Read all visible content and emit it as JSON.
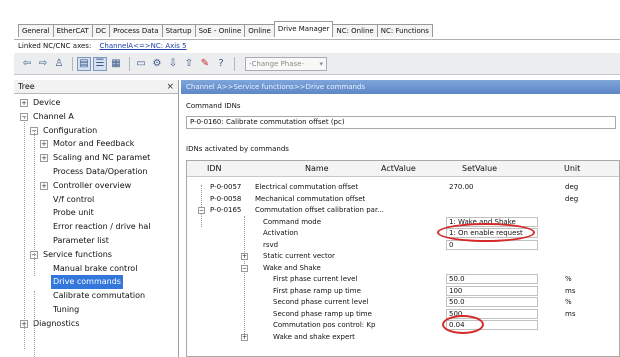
{
  "tabs": [
    "General",
    "EtherCAT",
    "DC",
    "Process Data",
    "Startup",
    "SoE - Online",
    "Online",
    "Drive Manager",
    "NC: Online",
    "NC: Functions"
  ],
  "active_tab": "Drive Manager",
  "linked": {
    "label": "Linked NC/CNC axes:",
    "value": "ChannelA<=>NC: Axis 5"
  },
  "toolbar": {
    "phase_placeholder": "-Change Phase-",
    "icons": [
      "arrow-left-icon",
      "arrow-right-icon",
      "person-icon",
      "tree-view-icon",
      "list-view-icon",
      "grid-icon",
      "properties-icon",
      "settings-icon",
      "download-icon",
      "upload-icon",
      "check-icon",
      "help-icon"
    ]
  },
  "tree": {
    "title": "Tree",
    "close": "×",
    "nodes": [
      {
        "label": "Device",
        "exp": "+"
      },
      {
        "label": "Channel A",
        "exp": "−"
      },
      {
        "label": "Configuration",
        "exp": "−"
      },
      {
        "label": "Motor and Feedback",
        "exp": "+"
      },
      {
        "label": "Scaling and NC paramet",
        "exp": "+"
      },
      {
        "label": "Process Data/Operation",
        "exp": ""
      },
      {
        "label": "Controller overview",
        "exp": "+"
      },
      {
        "label": "V/f control",
        "exp": ""
      },
      {
        "label": "Probe unit",
        "exp": ""
      },
      {
        "label": "Error reaction / drive hal",
        "exp": ""
      },
      {
        "label": "Parameter list",
        "exp": ""
      },
      {
        "label": "Service functions",
        "exp": "−"
      },
      {
        "label": "Manual brake control",
        "exp": ""
      },
      {
        "label": "Drive commands",
        "exp": "",
        "selected": true
      },
      {
        "label": "Calibrate commutation",
        "exp": ""
      },
      {
        "label": "Tuning",
        "exp": ""
      },
      {
        "label": "Diagnostics",
        "exp": "+"
      }
    ]
  },
  "main": {
    "breadcrumb": "Channel A>>Service functions>>Drive commands",
    "command_label": "Command IDNs",
    "command_value": "P-0-0160: Calibrate commutation offset (pc)",
    "idns_label": "IDNs activated by commands",
    "columns": [
      "IDN",
      "Name",
      "ActValue",
      "SetValue",
      "Unit"
    ],
    "rows": [
      {
        "idn": "P-0-0057",
        "name": "Electrical commutation offset",
        "act": "",
        "set": "270.00",
        "unit": "deg"
      },
      {
        "idn": "P-0-0058",
        "name": "Mechanical commutation offset",
        "act": "",
        "set": "",
        "unit": "deg"
      },
      {
        "idn": "P-0-0165",
        "name": "Commutation offset calibration par...",
        "act": "",
        "set": "",
        "unit": ""
      },
      {
        "idn": "",
        "name": "Command mode",
        "act": "",
        "set": "1: Wake and Shake",
        "unit": ""
      },
      {
        "idn": "",
        "name": "Activation",
        "act": "",
        "set": "1: On enable request",
        "unit": ""
      },
      {
        "idn": "",
        "name": "rsvd",
        "act": "",
        "set": "0",
        "unit": ""
      },
      {
        "idn": "",
        "name": "Static current vector",
        "act": "",
        "set": "",
        "unit": ""
      },
      {
        "idn": "",
        "name": "Wake and Shake",
        "act": "",
        "set": "",
        "unit": ""
      },
      {
        "idn": "",
        "name": "First phase current level",
        "act": "",
        "set": "50.0",
        "unit": "%"
      },
      {
        "idn": "",
        "name": "First phase ramp up time",
        "act": "",
        "set": "100",
        "unit": "ms"
      },
      {
        "idn": "",
        "name": "Second phase current level",
        "act": "",
        "set": "50.0",
        "unit": "%"
      },
      {
        "idn": "",
        "name": "Second phase ramp up time",
        "act": "",
        "set": "500",
        "unit": "ms"
      },
      {
        "idn": "",
        "name": "Commutation pos control: Kp",
        "act": "",
        "set": "0.04",
        "unit": ""
      },
      {
        "idn": "",
        "name": "Wake and shake expert",
        "act": "",
        "set": "",
        "unit": ""
      }
    ]
  },
  "colors": {
    "highlight": "#d42a2a",
    "selection": "#3377dd",
    "breadcrumb": "#5c86c6"
  }
}
